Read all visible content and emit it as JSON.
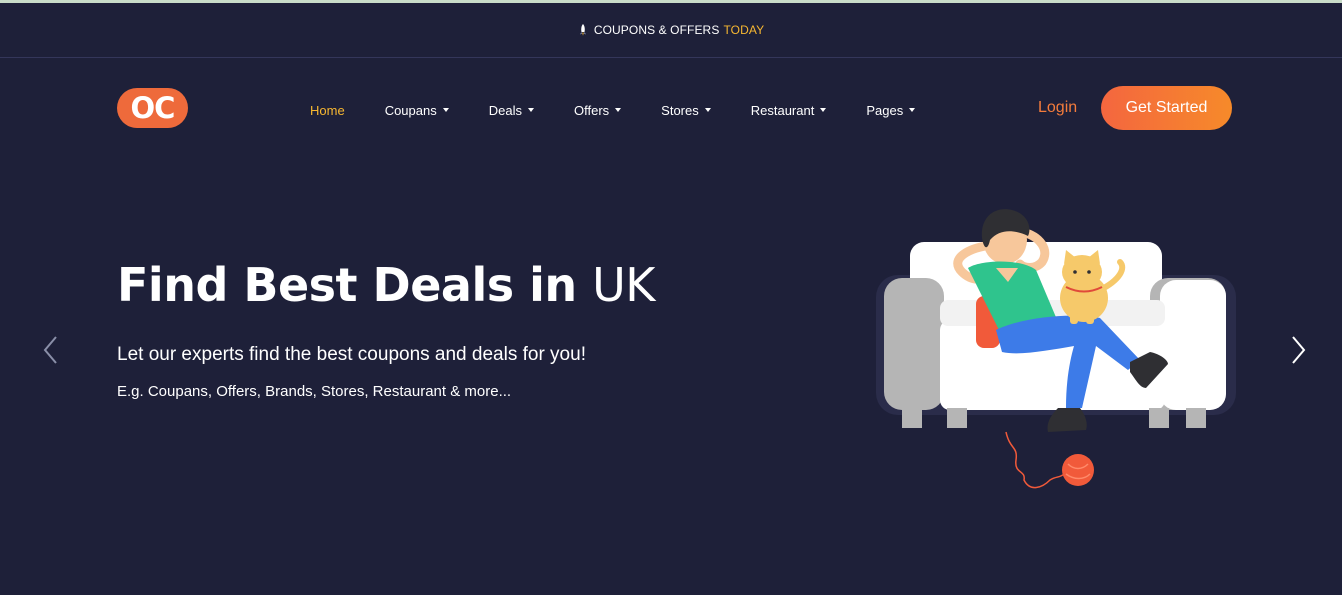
{
  "topbar": {
    "icon": "rocket-icon",
    "text": "COUPONS & OFFERS",
    "highlight": "TODAY"
  },
  "logo": {
    "text": "OC"
  },
  "nav": {
    "items": [
      {
        "label": "Home",
        "dropdown": false,
        "active": true
      },
      {
        "label": "Coupans",
        "dropdown": true,
        "active": false
      },
      {
        "label": "Deals",
        "dropdown": true,
        "active": false
      },
      {
        "label": "Offers",
        "dropdown": true,
        "active": false
      },
      {
        "label": "Stores",
        "dropdown": true,
        "active": false
      },
      {
        "label": "Restaurant",
        "dropdown": true,
        "active": false
      },
      {
        "label": "Pages",
        "dropdown": true,
        "active": false
      }
    ],
    "login": "Login",
    "cta": "Get Started"
  },
  "hero": {
    "title_bold": "Find Best Deals in",
    "title_light": "UK",
    "subtitle": "Let our experts find the best coupons and deals for you!",
    "note": "E.g. Coupans, Offers, Brands, Stores, Restaurant & more..."
  },
  "carousel": {
    "prev_icon": "chevron-left-icon",
    "next_icon": "chevron-right-icon"
  },
  "colors": {
    "background": "#1e2039",
    "accent": "#f7b731",
    "brand": "#ee6a3b",
    "login": "#f47c3c"
  }
}
